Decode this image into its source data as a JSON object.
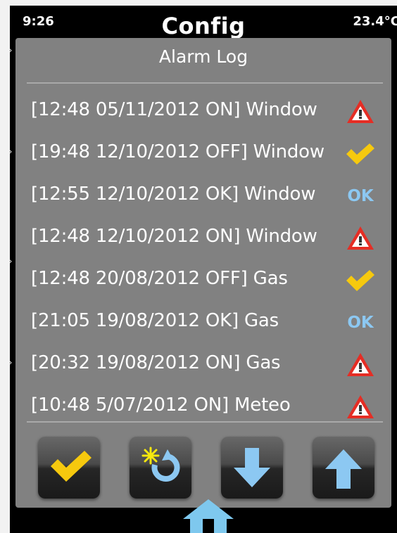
{
  "status_bar": {
    "time": "9:26",
    "title": "Config",
    "temperature": "23.4°C"
  },
  "dialog": {
    "title": "Alarm Log",
    "entries": [
      {
        "text": "[12:48 05/11/2012 ON] Window",
        "status": "alarm",
        "icon": "warning-triangle-icon"
      },
      {
        "text": "[19:48 12/10/2012 OFF] Window",
        "status": "off",
        "icon": "checkmark-icon"
      },
      {
        "text": "[12:55 12/10/2012 OK] Window",
        "status": "ok",
        "icon": "ok-text-icon",
        "icon_text": "OK"
      },
      {
        "text": "[12:48 12/10/2012 ON] Window",
        "status": "alarm",
        "icon": "warning-triangle-icon"
      },
      {
        "text": "[12:48 20/08/2012 OFF] Gas",
        "status": "off",
        "icon": "checkmark-icon"
      },
      {
        "text": "[21:05 19/08/2012 OK] Gas",
        "status": "ok",
        "icon": "ok-text-icon",
        "icon_text": "OK"
      },
      {
        "text": "[20:32 19/08/2012 ON] Gas",
        "status": "alarm",
        "icon": "warning-triangle-icon"
      },
      {
        "text": "[10:48 5/07/2012 ON] Meteo",
        "status": "alarm",
        "icon": "warning-triangle-icon"
      }
    ],
    "toolbar": {
      "buttons": [
        {
          "name": "confirm-button",
          "icon": "checkmark-icon"
        },
        {
          "name": "refresh-button",
          "icon": "refresh-icon"
        },
        {
          "name": "scroll-down-button",
          "icon": "arrow-down-icon"
        },
        {
          "name": "scroll-up-button",
          "icon": "arrow-up-icon"
        }
      ]
    }
  },
  "bottom_bar": {
    "icon": "home-icon"
  },
  "colors": {
    "dialog_bg": "#818181",
    "alarm_red": "#e52d24",
    "check_yellow": "#f6c90e",
    "ok_blue": "#8cc8f2",
    "home_blue": "#7ec8ee"
  }
}
